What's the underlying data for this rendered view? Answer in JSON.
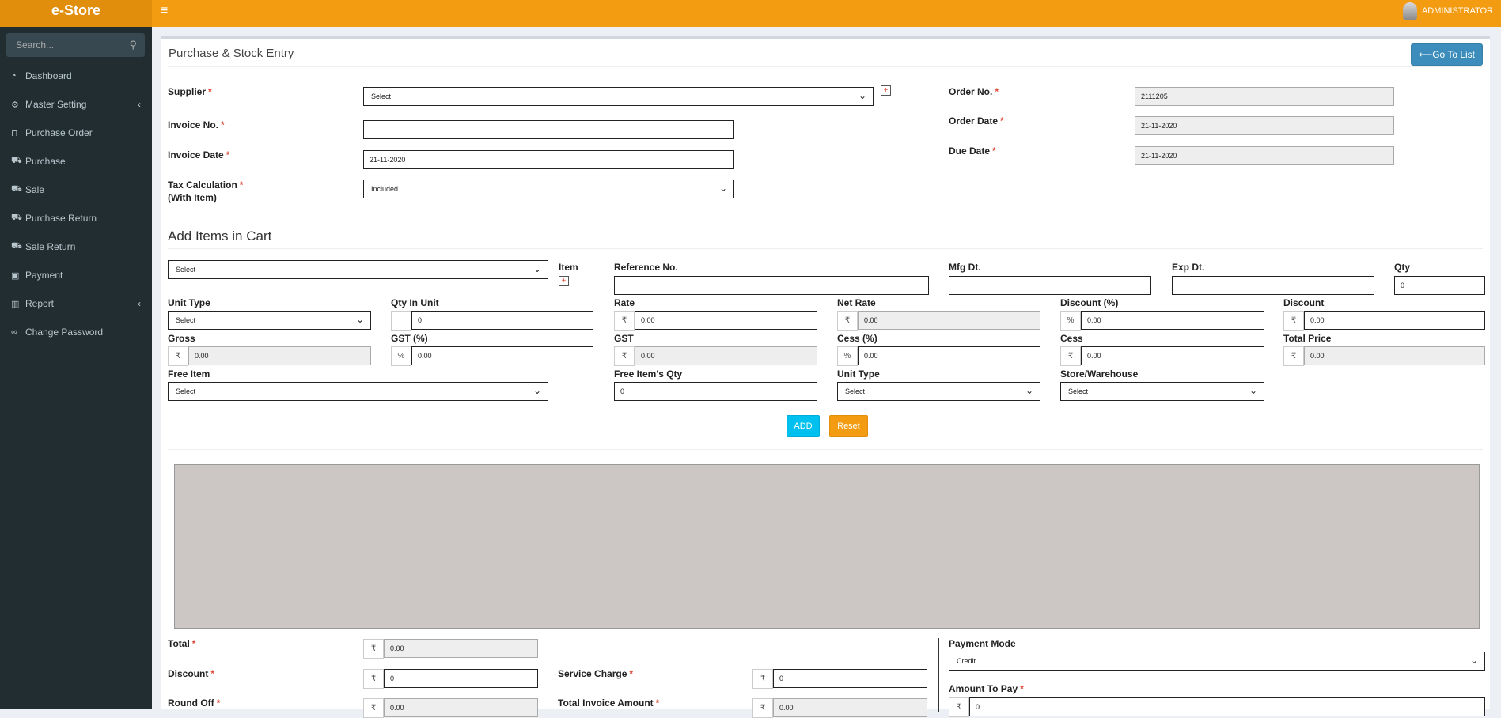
{
  "app": {
    "title": "e-Store",
    "user": "ADMINISTRATOR"
  },
  "sidebar": {
    "search_placeholder": "Search...",
    "items": [
      {
        "label": "Dashboard",
        "icon": "dashboard-icon"
      },
      {
        "label": "Master Setting",
        "icon": "gear-icon"
      },
      {
        "label": "Purchase Order",
        "icon": "basket-icon"
      },
      {
        "label": "Purchase",
        "icon": "cart-icon"
      },
      {
        "label": "Sale",
        "icon": "cart-icon"
      },
      {
        "label": "Purchase Return",
        "icon": "cart-icon"
      },
      {
        "label": "Sale Return",
        "icon": "cart-icon"
      },
      {
        "label": "Payment",
        "icon": "money-icon"
      },
      {
        "label": "Report",
        "icon": "bar-chart-icon"
      },
      {
        "label": "Change Password",
        "icon": "link-icon"
      }
    ]
  },
  "page": {
    "title": "Purchase & Stock Entry",
    "goto_label": "⟵Go To List",
    "section_title": "Add Items in Cart"
  },
  "header_form": {
    "supplier": {
      "label": "Supplier",
      "value": "Select"
    },
    "invoice_no": {
      "label": "Invoice No.",
      "value": ""
    },
    "invoice_date": {
      "label": "Invoice Date",
      "value": "21-11-2020"
    },
    "tax_calc": {
      "label": "Tax Calculation",
      "label2": "(With Item)",
      "value": "Included"
    },
    "order_no": {
      "label": "Order No.",
      "value": "2111205"
    },
    "order_date": {
      "label": "Order Date",
      "value": "21-11-2020"
    },
    "due_date": {
      "label": "Due Date",
      "value": "21-11-2020"
    }
  },
  "cart": {
    "item_select": "Select",
    "item_label": "Item",
    "reference_no": {
      "label": "Reference No.",
      "value": ""
    },
    "mfg_dt": {
      "label": "Mfg Dt.",
      "value": ""
    },
    "exp_dt": {
      "label": "Exp Dt.",
      "value": ""
    },
    "qty": {
      "label": "Qty",
      "value": "0"
    },
    "unit_type": {
      "label": "Unit Type",
      "value": "Select"
    },
    "qty_in_unit": {
      "label": "Qty In Unit",
      "value": "0"
    },
    "rate": {
      "label": "Rate",
      "value": "0.00"
    },
    "net_rate": {
      "label": "Net Rate",
      "value": "0.00"
    },
    "discount_pct": {
      "label": "Discount (%)",
      "value": "0.00"
    },
    "discount": {
      "label": "Discount",
      "value": "0.00"
    },
    "gross": {
      "label": "Gross",
      "value": "0.00"
    },
    "gst_pct": {
      "label": "GST (%)",
      "value": "0.00"
    },
    "gst": {
      "label": "GST",
      "value": "0.00"
    },
    "cess_pct": {
      "label": "Cess (%)",
      "value": "0.00"
    },
    "cess": {
      "label": "Cess",
      "value": "0.00"
    },
    "total_price": {
      "label": "Total Price",
      "value": "0.00"
    },
    "free_item": {
      "label": "Free Item",
      "value": "Select"
    },
    "free_qty": {
      "label": "Free Item's Qty",
      "value": "0"
    },
    "unit_type2": {
      "label": "Unit Type",
      "value": "Select"
    },
    "store": {
      "label": "Store/Warehouse",
      "value": "Select"
    },
    "add_label": "ADD",
    "reset_label": "Reset"
  },
  "totals": {
    "total": {
      "label": "Total",
      "value": "0.00"
    },
    "discount": {
      "label": "Discount",
      "value": "0"
    },
    "round_off": {
      "label": "Round Off",
      "value": "0.00"
    },
    "service_charge": {
      "label": "Service Charge",
      "value": "0"
    },
    "total_invoice": {
      "label": "Total Invoice Amount",
      "value": "0.00"
    },
    "payment_mode": {
      "label": "Payment Mode",
      "value": "Credit"
    },
    "amount_to_pay": {
      "label": "Amount To Pay",
      "value": "0"
    }
  },
  "symbols": {
    "rupee": "₹",
    "percent": "%",
    "plus": "+"
  },
  "colors": {
    "accent": "#f39c12",
    "sidebar": "#222d32",
    "primary": "#3c8dbc",
    "info": "#00c0ef",
    "warning": "#f39c12"
  }
}
